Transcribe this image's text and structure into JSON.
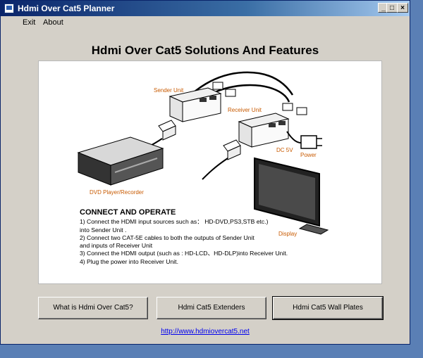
{
  "window": {
    "title": "Hdmi Over Cat5 Planner",
    "controls": {
      "minimize": "_",
      "maximize": "□",
      "close": "×"
    }
  },
  "menu": {
    "items": [
      "Exit",
      "About"
    ]
  },
  "heading": "Hdmi Over Cat5 Solutions And Features",
  "figure": {
    "labels": {
      "sender": "Sender Unit",
      "receiver": "Receiver Unit",
      "dc": "DC 5V",
      "power": "Power",
      "dvd": "DVD Player/Recorder",
      "display": "Display"
    },
    "instructions": {
      "title": "CONNECT AND OPERATE",
      "lines": [
        "1) Connect the HDMI input sources such as： HD-DVD,PS3,STB etc.)",
        "     into  Sender Unit .",
        "2) Connect two CAT-5E cables to both the outputs of  Sender Unit",
        "     and inputs of Receiver Unit",
        "3) Connect the HDMI output (such as : HD-LCD、HD-DLP)into Receiver Unit.",
        "4) Plug the power into  Receiver Unit."
      ]
    }
  },
  "buttons": [
    "What is Hdmi Over Cat5?",
    "Hdmi Cat5 Extenders",
    "Hdmi Cat5 Wall Plates"
  ],
  "link": "http://www.hdmiovercat5.net"
}
